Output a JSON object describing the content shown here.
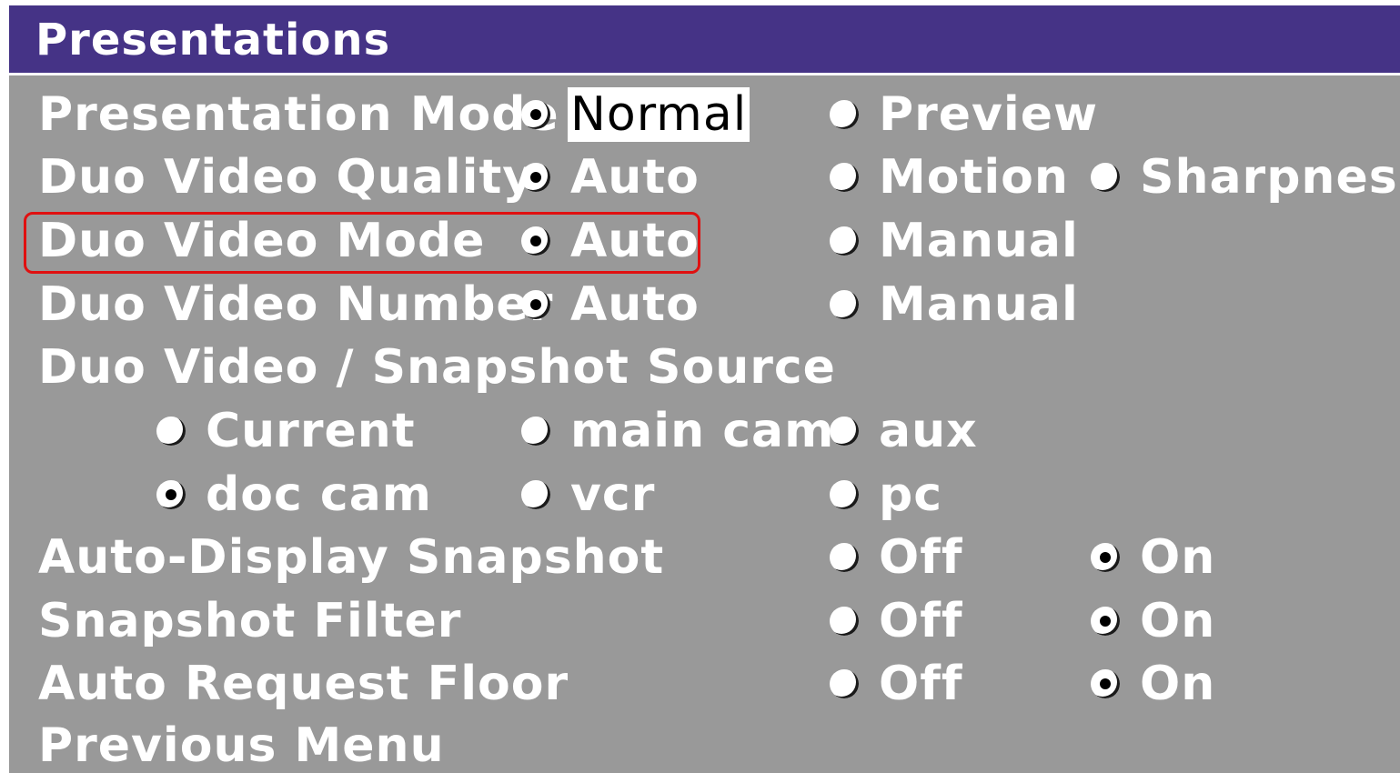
{
  "title": "Presentations",
  "rows": {
    "presentation_mode": {
      "label": "Presentation Mode",
      "options": [
        "Normal",
        "Preview"
      ],
      "selected": "Normal"
    },
    "duo_video_quality": {
      "label": "Duo Video Quality",
      "options": [
        "Auto",
        "Motion",
        "Sharpness"
      ],
      "selected": "Auto"
    },
    "duo_video_mode": {
      "label": "Duo Video Mode",
      "options": [
        "Auto",
        "Manual"
      ],
      "selected": "Auto"
    },
    "duo_video_number": {
      "label": "Duo Video Number",
      "options": [
        "Auto",
        "Manual"
      ],
      "selected": "Auto"
    },
    "source": {
      "label": "Duo Video / Snapshot Source",
      "options": [
        "Current",
        "main cam",
        "aux",
        "doc cam",
        "vcr",
        "pc"
      ],
      "selected": "doc cam"
    },
    "auto_display_snapshot": {
      "label": "Auto-Display Snapshot",
      "options": [
        "Off",
        "On"
      ],
      "selected": "On"
    },
    "snapshot_filter": {
      "label": "Snapshot Filter",
      "options": [
        "Off",
        "On"
      ],
      "selected": "On"
    },
    "auto_request_floor": {
      "label": "Auto Request Floor",
      "options": [
        "Off",
        "On"
      ],
      "selected": "On"
    }
  },
  "previous_menu": "Previous Menu",
  "colors": {
    "titlebar": "#453386",
    "panel": "#999999",
    "highlight_border": "#e01010"
  }
}
